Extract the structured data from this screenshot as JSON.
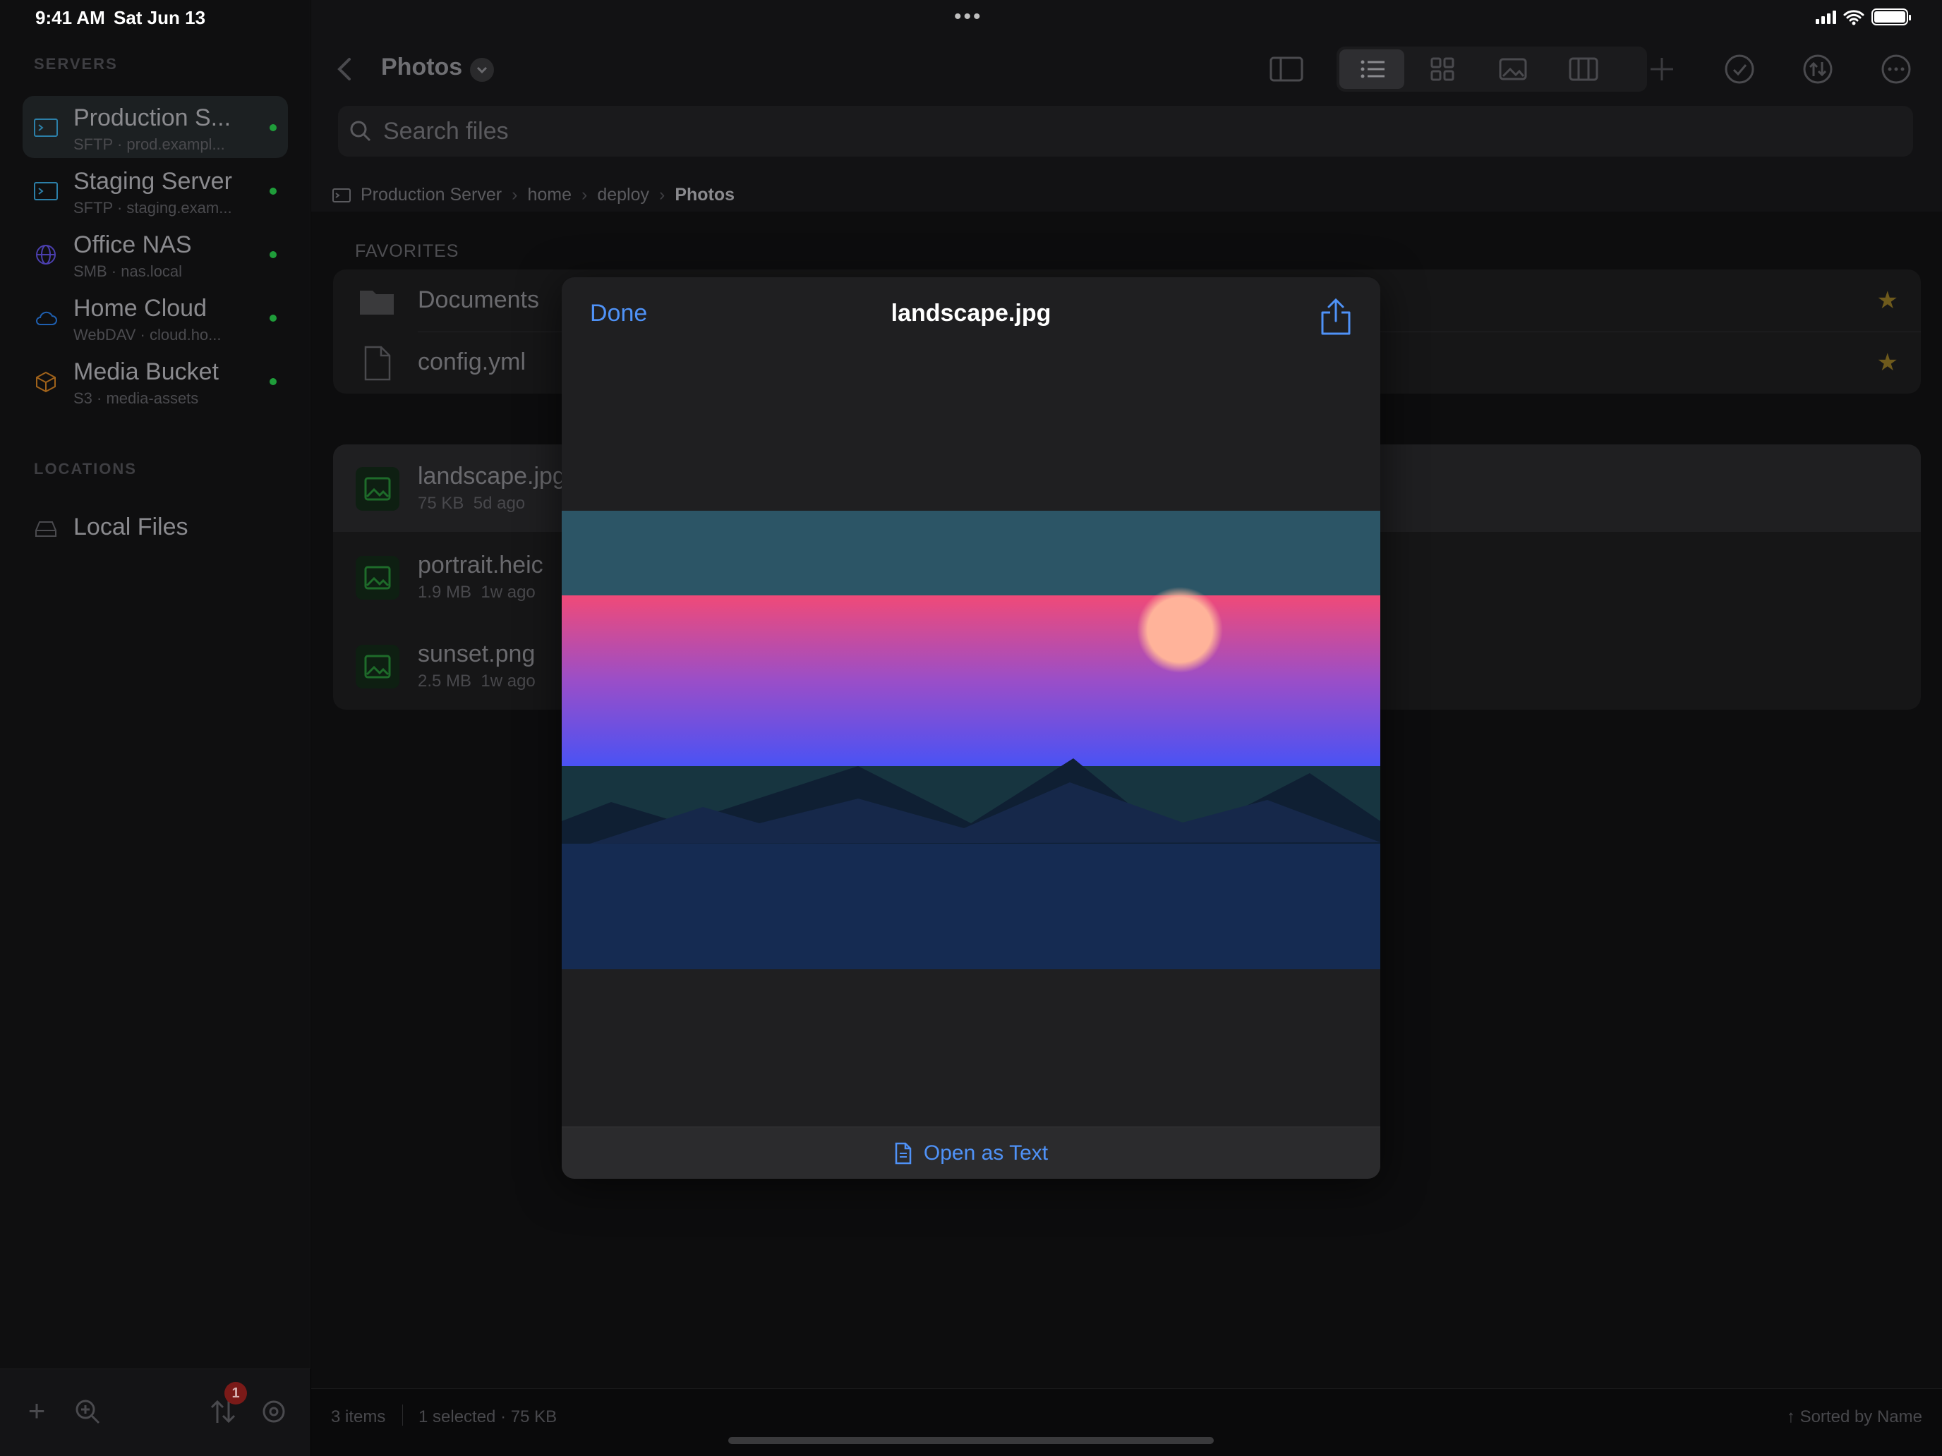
{
  "status": {
    "time": "9:41 AM",
    "date": "Sat Jun 13"
  },
  "sidebar": {
    "servers_header": "SERVERS",
    "servers": [
      {
        "name": "Production S...",
        "sub": "SFTP · prod.exampl...",
        "icon": "terminal-icon",
        "online": true,
        "selected": true
      },
      {
        "name": "Staging Server",
        "sub": "SFTP · staging.exam...",
        "icon": "terminal-icon",
        "online": true
      },
      {
        "name": "Office NAS",
        "sub": "SMB · nas.local",
        "icon": "globe-icon",
        "online": true
      },
      {
        "name": "Home Cloud",
        "sub": "WebDAV · cloud.ho...",
        "icon": "cloud-icon",
        "online": true
      },
      {
        "name": "Media Bucket",
        "sub": "S3 · media-assets",
        "icon": "box-icon",
        "online": true
      }
    ],
    "locations_header": "LOCATIONS",
    "locations": [
      {
        "name": "Local Files",
        "icon": "drive-icon"
      }
    ],
    "transfers_badge": "1"
  },
  "header": {
    "title": "Photos",
    "search_placeholder": "Search files"
  },
  "breadcrumb": [
    "Production Server",
    "home",
    "deploy",
    "Photos"
  ],
  "favorites": {
    "header": "FAVORITES",
    "items": [
      {
        "name": "Documents",
        "type": "folder",
        "starred": true
      },
      {
        "name": "config.yml",
        "type": "file",
        "starred": true
      }
    ]
  },
  "files": [
    {
      "name": "landscape.jpg",
      "size": "75 KB",
      "age": "5d ago",
      "selected": true
    },
    {
      "name": "portrait.heic",
      "size": "1.9 MB",
      "age": "1w ago"
    },
    {
      "name": "sunset.png",
      "size": "2.5 MB",
      "age": "1w ago"
    }
  ],
  "footer": {
    "count": "3 items",
    "selection": "1 selected · 75 KB",
    "sort": "Sorted by Name"
  },
  "preview": {
    "done": "Done",
    "title": "landscape.jpg",
    "open_as_text": "Open as Text"
  },
  "colors": {
    "accent": "#4f92f7",
    "online": "#1f9d3a",
    "star": "#6e5a1c"
  }
}
